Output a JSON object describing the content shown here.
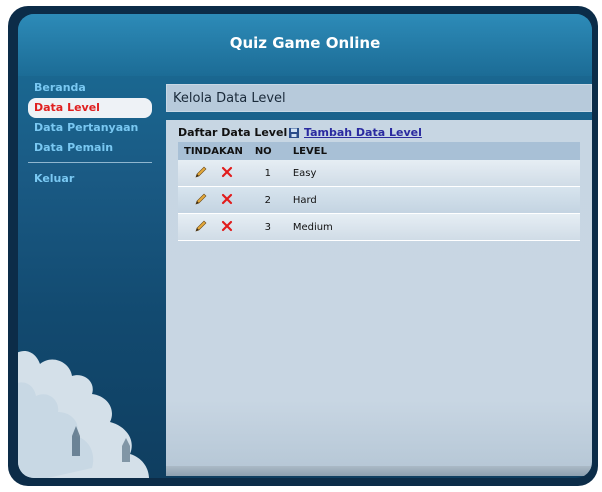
{
  "site": {
    "title": "Quiz Game Online"
  },
  "sidebar": {
    "items": [
      {
        "label": "Beranda",
        "active": false
      },
      {
        "label": "Data Level",
        "active": true
      },
      {
        "label": "Data Pertanyaan",
        "active": false
      },
      {
        "label": "Data Pemain",
        "active": false
      }
    ],
    "logout": "Keluar"
  },
  "main": {
    "title": "Kelola Data Level",
    "list_header": "Daftar Data Level",
    "add_link": "Tambah Data Level",
    "table": {
      "headers": {
        "action": "TINDAKAN",
        "no": "NO",
        "level": "LEVEL"
      },
      "rows": [
        {
          "no": "1",
          "level": "Easy"
        },
        {
          "no": "2",
          "level": "Hard"
        },
        {
          "no": "3",
          "level": "Medium"
        }
      ]
    }
  },
  "colors": {
    "accent": "#79c8f2",
    "active_text": "#e02020",
    "link": "#2a2aa0"
  }
}
